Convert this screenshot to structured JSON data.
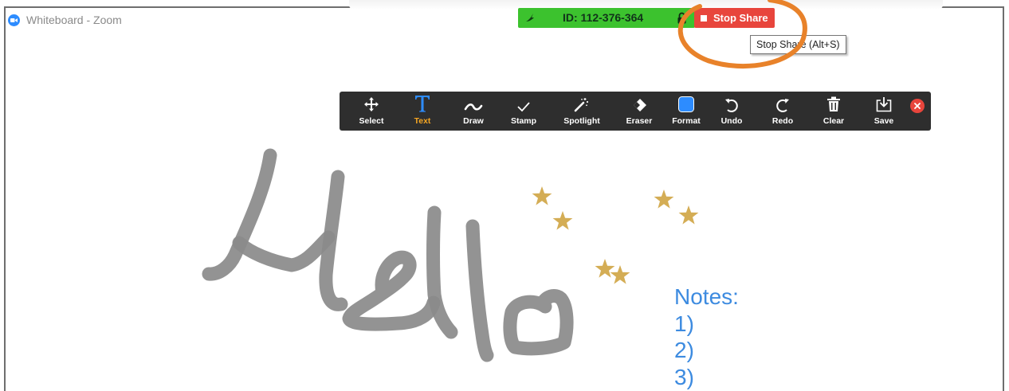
{
  "window": {
    "title": "Whiteboard - Zoom"
  },
  "meeting_bar": {
    "meeting_id": "ID: 112-376-364",
    "stop_share_label": "Stop Share",
    "tooltip": "Stop Share (Alt+S)"
  },
  "toolbar": {
    "tools": [
      {
        "label": "Select",
        "icon": "move-arrows-icon"
      },
      {
        "label": "Text",
        "icon": "text-t-icon"
      },
      {
        "label": "Draw",
        "icon": "squiggle-icon"
      },
      {
        "label": "Stamp",
        "icon": "checkmark-icon"
      },
      {
        "label": "Spotlight",
        "icon": "magic-wand-icon"
      },
      {
        "label": "Eraser",
        "icon": "eraser-icon"
      },
      {
        "label": "Format",
        "icon": "color-square-icon"
      },
      {
        "label": "Undo",
        "icon": "undo-icon"
      },
      {
        "label": "Redo",
        "icon": "redo-icon"
      },
      {
        "label": "Clear",
        "icon": "trash-icon"
      },
      {
        "label": "Save",
        "icon": "save-download-icon"
      }
    ],
    "active_tool": "Text"
  },
  "whiteboard": {
    "notes": [
      "Notes:",
      "1)",
      "2)",
      "3)"
    ]
  },
  "colors": {
    "meeting_bar_green": "#3cc22e",
    "stop_share_red": "#e8453c",
    "toolbar_bg": "#2e2e2e",
    "active_tool_label": "#f5a623",
    "format_blue": "#2d8cff",
    "pen_gray": "#8a8a8a",
    "star_gold": "#d4ad55",
    "notes_blue": "#3d8be0",
    "highlight_orange": "#e8822a"
  }
}
